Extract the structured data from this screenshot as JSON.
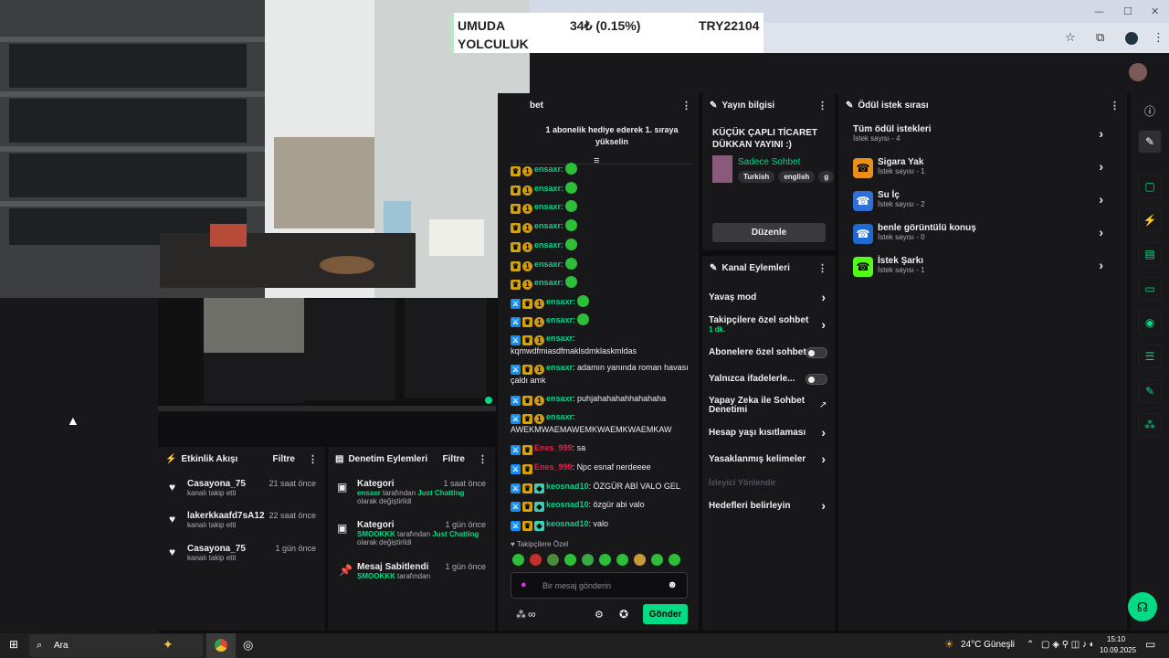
{
  "ticker": {
    "title_l1": "UMUDA",
    "title_l2": "YOLCULUK",
    "price": "34₺ (0.15%)",
    "goal": "TRY22104"
  },
  "window_controls": {
    "min": "—",
    "max": "☐",
    "close": "✕"
  },
  "chat": {
    "header": "bet",
    "gift_banner": "1 abonelik hediye ederek 1. sıraya yükselin",
    "repeat_user": "ensaxr:",
    "lines": [
      {
        "user": "ensaxr",
        "msg": "kqmwdfmiasdfmaklsdmklaskmldas"
      },
      {
        "user": "ensaxr",
        "msg": "adamın yanında roman havası çaldı amk"
      },
      {
        "user": "ensaxr",
        "msg": "puhjahahahahhahahaha"
      },
      {
        "user": "ensaxr",
        "msg": "AWEKMWAEMAWEMKWAEMKWAEMKAW"
      },
      {
        "user": "Enes_999",
        "msg": "sa"
      },
      {
        "user": "Enes_999",
        "msg": "Npc esnaf nerdeeee"
      },
      {
        "user": "keosnad10",
        "msg": "ÖZGÜR ABİ VALO GEL"
      },
      {
        "user": "keosnad10",
        "msg": "özgür abi valo"
      },
      {
        "user": "keosnad10",
        "msg": "valo"
      }
    ],
    "followers_label": "Takipçilere Özel",
    "input_placeholder": "Bir mesaj gönderin",
    "infinity": "∞",
    "send": "Gönder"
  },
  "stream_info": {
    "header": "Yayın bilgisi",
    "title": "KÜÇÜK ÇAPLI TİCARET DÜKKAN YAYINI :)",
    "category": "Sadece Sohbet",
    "tags": [
      "Turkish",
      "english",
      "g"
    ],
    "edit": "Düzenle"
  },
  "channel_actions": {
    "header": "Kanal Eylemleri",
    "items": {
      "slow": "Yavaş mod",
      "followers": "Takipçilere özel sohbet",
      "followers_sub": "1 dk.",
      "subs": "Abonelere özel sohbet",
      "emotes": "Yalnızca ifadelerle...",
      "ai": "Yapay Zeka ile Sohbet Denetimi",
      "age": "Hesap yaşı kısıtlaması",
      "banned": "Yasaklanmış kelimeler",
      "viewer": "İzleyici Yönlendir",
      "targets": "Hedefleri belirleyin"
    }
  },
  "rewards": {
    "header": "Ödül istek sırası",
    "all": "Tüm ödül istekleri",
    "all_sub": "İstek sayısı - 4",
    "items": [
      {
        "name": "Sigara Yak",
        "sub": "İstek sayısı - 1",
        "color": "#e8901a"
      },
      {
        "name": "Su İç",
        "sub": "İstek sayısı - 2",
        "color": "#2f6fd6"
      },
      {
        "name": "benle görüntülü konuş",
        "sub": "İstek sayısı - 0",
        "color": "#1f6ad0"
      },
      {
        "name": "İstek Şarkı",
        "sub": "İstek sayısı - 1",
        "color": "#53fc18"
      }
    ]
  },
  "activity": {
    "header": "Etkinlik Akışı",
    "filter": "Filtre",
    "items": [
      {
        "name": "Casayona_75",
        "sub": "kanalı takip etti",
        "time": "21 saat önce"
      },
      {
        "name": "lakerkkaafd7sA12",
        "sub": "kanalı takip etti",
        "time": "22 saat önce"
      },
      {
        "name": "Casayona_75",
        "sub": "kanalı takip etti",
        "time": "1 gün önce"
      }
    ]
  },
  "moderation": {
    "header": "Denetim Eylemleri",
    "filter": "Filtre",
    "items": [
      {
        "title": "Kategori",
        "user": "ensaxr",
        "mid": " tarafından ",
        "cat": "Just Chatting",
        "tail": "olarak değiştirildi",
        "time": "1 saat önce"
      },
      {
        "title": "Kategori",
        "user": "SMOOKKK",
        "mid": " tarafından ",
        "cat": "Just Chatting",
        "tail": "olarak değiştirildi",
        "time": "1 gün önce"
      },
      {
        "title": "Mesaj Sabitlendi",
        "user": "SMOOKKK",
        "mid": " tarafından",
        "cat": "",
        "tail": "",
        "time": "1 gün önce"
      }
    ]
  },
  "taskbar": {
    "search": "Ara",
    "weather": "24°C Güneşli",
    "time": "15:10",
    "date": "10.09.2025"
  },
  "colors": {
    "accent": "#00db84",
    "bg": "#0e0e10",
    "panel": "#18181b"
  }
}
